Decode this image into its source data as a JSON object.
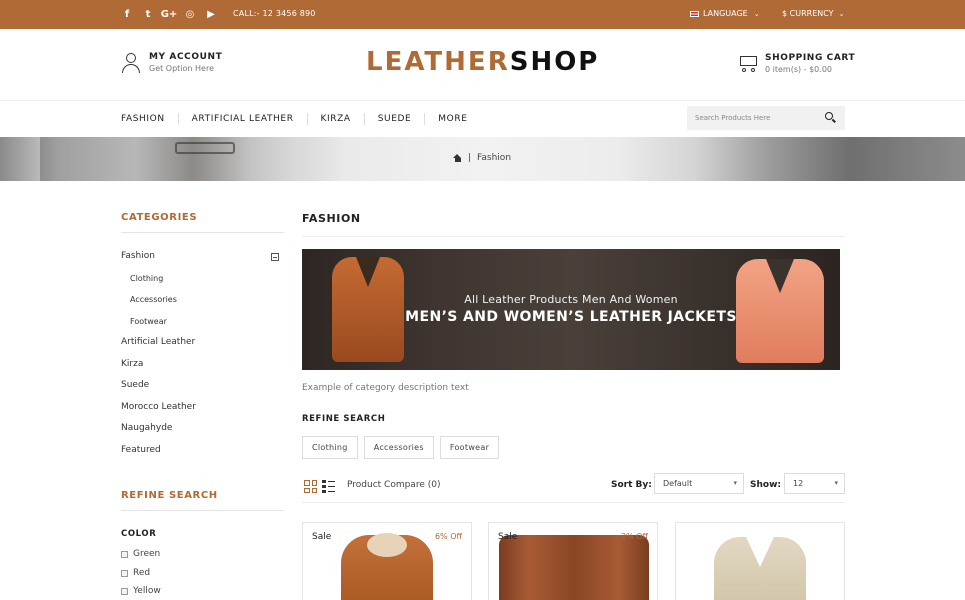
{
  "colors": {
    "accent": "#b06a35",
    "topbar": "#b06a35"
  },
  "topbar": {
    "social_icons": [
      "facebook-icon",
      "twitter-icon",
      "google-plus-icon",
      "instagram-icon",
      "youtube-icon"
    ],
    "social_glyphs": [
      "f",
      "t",
      "G+",
      "◎",
      "▶"
    ],
    "call": "CALL:- 12 3456 890",
    "language": "LANGUAGE",
    "currency": "$ CURRENCY"
  },
  "header": {
    "account_title": "MY ACCOUNT",
    "account_sub": "Get Option Here",
    "logo_part1": "LEATHER",
    "logo_part2": "SHOP",
    "cart_title": "SHOPPING CART",
    "cart_sub": "0 item(s) - $0.00"
  },
  "nav": {
    "items": [
      "FASHION",
      "ARTIFICIAL LEATHER",
      "KIRZA",
      "SUEDE",
      "MORE"
    ],
    "search_placeholder": "Search Products Here"
  },
  "breadcrumb": {
    "current": "Fashion"
  },
  "sidebar": {
    "categories_title": "CATEGORIES",
    "categories": [
      {
        "label": "Fashion",
        "sub": false
      },
      {
        "label": "Clothing",
        "sub": true
      },
      {
        "label": "Accessories",
        "sub": true
      },
      {
        "label": "Footwear",
        "sub": true
      },
      {
        "label": "Artificial Leather",
        "sub": false
      },
      {
        "label": "Kirza",
        "sub": false
      },
      {
        "label": "Suede",
        "sub": false
      },
      {
        "label": "Morocco Leather",
        "sub": false
      },
      {
        "label": "Naugahyde",
        "sub": false
      },
      {
        "label": "Featured",
        "sub": false
      }
    ],
    "refine_title": "REFINE SEARCH",
    "color_title": "COLOR",
    "colors": [
      "Green",
      "Red",
      "Yellow"
    ]
  },
  "main": {
    "title": "FASHION",
    "banner_line1": "All Leather Products Men And Women",
    "banner_line2": "MEN’S AND WOMEN’S LEATHER JACKETS",
    "description": "Example of category description text",
    "refine_title": "REFINE SEARCH",
    "refine_chips": [
      "Clothing",
      "Accessories",
      "Footwear"
    ],
    "compare": "Product Compare (0)",
    "sort_label": "Sort By:",
    "sort_value": "Default",
    "show_label": "Show:",
    "show_value": "12"
  },
  "products": [
    {
      "badge": "Sale",
      "discount": "6% Off"
    },
    {
      "badge": "Sale",
      "discount": "2% Off"
    },
    {
      "badge": "",
      "discount": ""
    }
  ]
}
